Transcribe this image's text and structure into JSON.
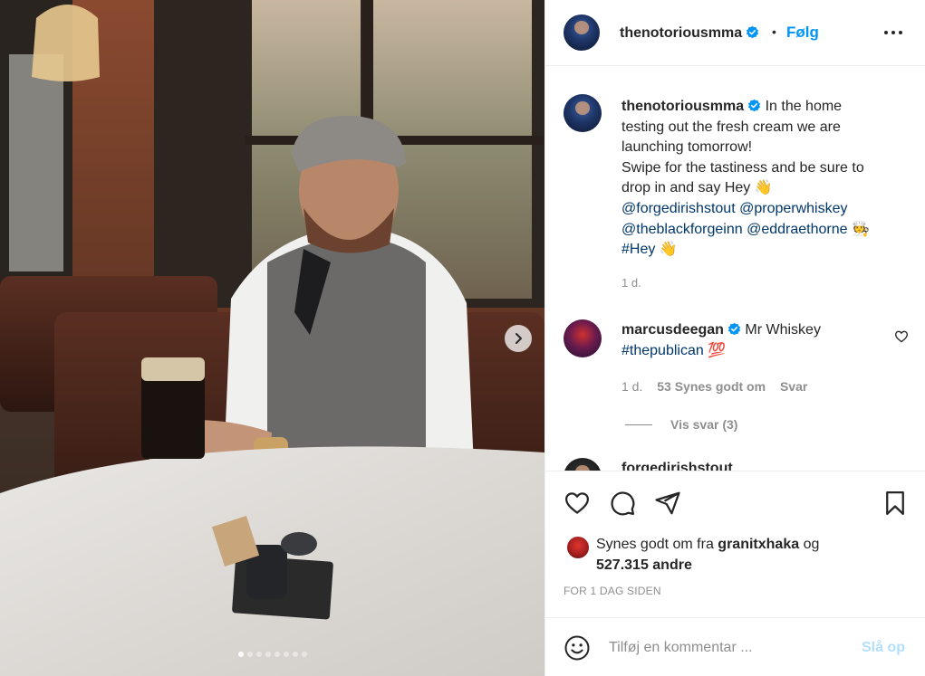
{
  "post": {
    "image": {
      "carousel_count": 8,
      "active_index": 0
    }
  },
  "header": {
    "username": "thenotoriousmma",
    "separator": "•",
    "follow_label": "Følg"
  },
  "caption": {
    "username": "thenotoriousmma",
    "line1": "In the home",
    "line2": "testing out the fresh cream we are",
    "line3": "launching tomorrow!",
    "line4": "Swipe for the tastiness and be sure to",
    "line5": "drop in and say Hey 👋",
    "mention1": "@forgedirishstout",
    "mention2": "@properwhiskey",
    "mention3": "@theblackforgeinn",
    "mention4": "@eddraethorne",
    "emoji_after_mention4": "🧑‍🍳",
    "hashtag": "#Hey",
    "hashtag_emoji": "👋",
    "time": "1 d."
  },
  "comment": {
    "username": "marcusdeegan",
    "text": "Mr Whiskey",
    "hashtag": "#thepublican",
    "emoji": "💯",
    "time": "1 d.",
    "likes": "53 Synes godt om",
    "reply_label": "Svar",
    "view_replies": "Vis svar (3)"
  },
  "next_comment_partial": {
    "username": "forgedirishstout"
  },
  "likes": {
    "prefix": "Synes godt om fra",
    "user": "granitxhaka",
    "conjunction": "og",
    "count": "527.315 andre"
  },
  "timestamp": "FOR 1 DAG SIDEN",
  "add_comment": {
    "placeholder": "Tilføj en kommentar ...",
    "post_label": "Slå op"
  },
  "colors": {
    "link": "#00376b",
    "accent": "#0095f6",
    "verified": "#0095f6",
    "muted": "#8e8e8e",
    "post_disabled": "#b2dffc"
  }
}
